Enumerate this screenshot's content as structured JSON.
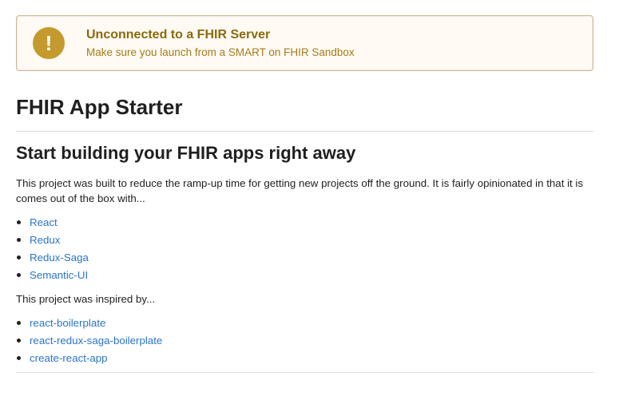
{
  "warning": {
    "icon": "exclamation-icon",
    "icon_glyph": "!",
    "title": "Unconnected to a FHIR Server",
    "subtitle": "Make sure you launch from a SMART on FHIR Sandbox",
    "colors": {
      "background": "#fffaf3",
      "border": "#c9ba9b",
      "icon": "#c49a2e",
      "title": "#8a6a0c",
      "subtitle": "#a37c1a"
    }
  },
  "main": {
    "title": "FHIR App Starter",
    "heading": "Start building your FHIR apps right away",
    "intro": "This project was built to reduce the ramp-up time for getting new projects off the ground. It is fairly opinionated in that it is comes out of the box with...",
    "built_with": [
      {
        "label": "React"
      },
      {
        "label": "Redux"
      },
      {
        "label": "Redux-Saga"
      },
      {
        "label": "Semantic-UI"
      }
    ],
    "inspired_text": "This project was inspired by...",
    "inspired_by": [
      {
        "label": "react-boilerplate"
      },
      {
        "label": "react-redux-saga-boilerplate"
      },
      {
        "label": "create-react-app"
      }
    ],
    "link_color": "#2a75c7"
  }
}
